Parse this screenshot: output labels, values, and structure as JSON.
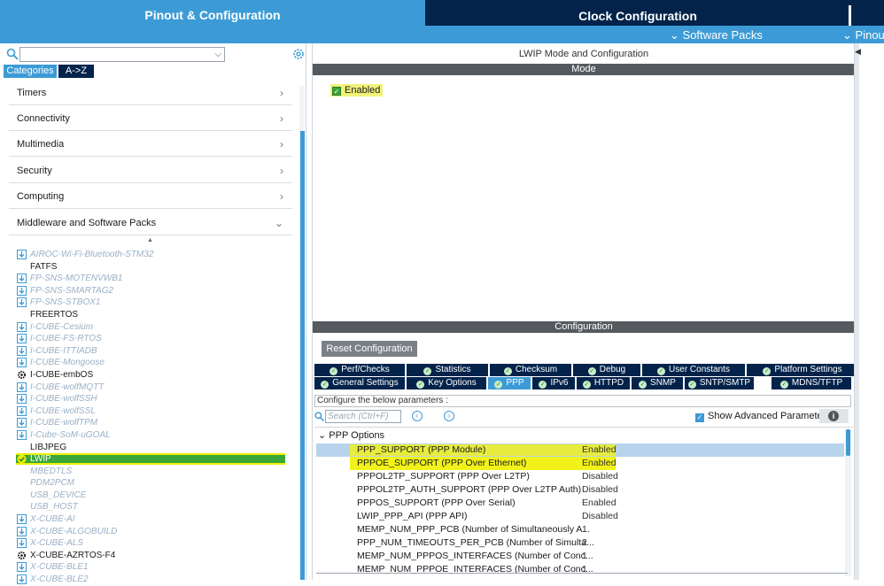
{
  "tabs": {
    "pinout": "Pinout & Configuration",
    "clock": "Clock Configuration"
  },
  "subbar": {
    "software_packs": "Software Packs",
    "pinout": "Pinout"
  },
  "left": {
    "search_value": "",
    "cat_tabs": [
      "Categories",
      "A->Z"
    ],
    "categories": [
      "Timers",
      "Connectivity",
      "Multimedia",
      "Security",
      "Computing",
      "Middleware and Software Packs"
    ],
    "packs": [
      {
        "label": "AIROC-Wi-Fi-Bluetooth-STM32",
        "style": "dim",
        "icon": "download"
      },
      {
        "label": "FATFS",
        "style": "norm",
        "icon": "none"
      },
      {
        "label": "FP-SNS-MOTENVWB1",
        "style": "dim",
        "icon": "download"
      },
      {
        "label": "FP-SNS-SMARTAG2",
        "style": "dim",
        "icon": "download"
      },
      {
        "label": "FP-SNS-STBOX1",
        "style": "dim",
        "icon": "download"
      },
      {
        "label": "FREERTOS",
        "style": "norm",
        "icon": "none"
      },
      {
        "label": "I-CUBE-Cesium",
        "style": "dim",
        "icon": "download"
      },
      {
        "label": "I-CUBE-FS-RTOS",
        "style": "dim",
        "icon": "download"
      },
      {
        "label": "I-CUBE-ITTIADB",
        "style": "dim",
        "icon": "download"
      },
      {
        "label": "I-CUBE-Mongoose",
        "style": "dim",
        "icon": "download"
      },
      {
        "label": "I-CUBE-embOS",
        "style": "norm",
        "icon": "gear"
      },
      {
        "label": "I-CUBE-wolfMQTT",
        "style": "dim",
        "icon": "download"
      },
      {
        "label": "I-CUBE-wolfSSH",
        "style": "dim",
        "icon": "download"
      },
      {
        "label": "I-CUBE-wolfSSL",
        "style": "dim",
        "icon": "download"
      },
      {
        "label": "I-CUBE-wolfTPM",
        "style": "dim",
        "icon": "download"
      },
      {
        "label": "I-Cube-SoM-uGOAL",
        "style": "dim",
        "icon": "download"
      },
      {
        "label": "LIBJPEG",
        "style": "norm",
        "icon": "none"
      },
      {
        "label": "LWIP",
        "style": "sel",
        "icon": "check"
      },
      {
        "label": "MBEDTLS",
        "style": "dim",
        "icon": "none"
      },
      {
        "label": "PDM2PCM",
        "style": "dim",
        "icon": "none"
      },
      {
        "label": "USB_DEVICE",
        "style": "dim",
        "icon": "none"
      },
      {
        "label": "USB_HOST",
        "style": "dim",
        "icon": "none"
      },
      {
        "label": "X-CUBE-AI",
        "style": "dim",
        "icon": "download"
      },
      {
        "label": "X-CUBE-ALGOBUILD",
        "style": "dim",
        "icon": "download"
      },
      {
        "label": "X-CUBE-ALS",
        "style": "dim",
        "icon": "download"
      },
      {
        "label": "X-CUBE-AZRTOS-F4",
        "style": "norm",
        "icon": "gear"
      },
      {
        "label": "X-CUBE-BLE1",
        "style": "dim",
        "icon": "download"
      },
      {
        "label": "X-CUBE-BLE2",
        "style": "dim",
        "icon": "download"
      }
    ]
  },
  "right": {
    "title": "LWIP Mode and Configuration",
    "mode_header": "Mode",
    "enabled_label": "Enabled",
    "config_header": "Configuration",
    "reset_label": "Reset Configuration",
    "tab_row1": [
      "Perf/Checks",
      "Statistics",
      "Checksum",
      "Debug",
      "User Constants",
      "Platform Settings"
    ],
    "tab_row2": [
      "General Settings",
      "Key Options",
      "PPP",
      "IPv6",
      "HTTPD",
      "SNMP",
      "SNTP/SMTP",
      "MDNS/TFTP"
    ],
    "configure_label": "Configure the below parameters :",
    "search_placeholder": "Search (Ctrl+F)",
    "show_advanced": "Show Advanced Parameters",
    "group_label": "PPP Options",
    "params": [
      {
        "name": "PPP_SUPPORT (PPP Module)",
        "value": "Enabled"
      },
      {
        "name": "PPPOE_SUPPORT (PPP Over Ethernet)",
        "value": "Enabled"
      },
      {
        "name": "PPPOL2TP_SUPPORT (PPP Over L2TP)",
        "value": "Disabled"
      },
      {
        "name": "PPPOL2TP_AUTH_SUPPORT (PPP Over L2TP Auth)",
        "value": "Disabled"
      },
      {
        "name": "PPPOS_SUPPORT (PPP Over Serial)",
        "value": "Enabled"
      },
      {
        "name": "LWIP_PPP_API (PPP API)",
        "value": "Disabled"
      },
      {
        "name": "MEMP_NUM_PPP_PCB (Number of Simultaneously A...",
        "value": "1"
      },
      {
        "name": "PPP_NUM_TIMEOUTS_PER_PCB (Number of Simulta...",
        "value": "2"
      },
      {
        "name": "MEMP_NUM_PPPOS_INTERFACES (Number of Conc...",
        "value": "1"
      },
      {
        "name": "MEMP_NUM_PPPOE_INTERFACES (Number of Conc...",
        "value": "1"
      }
    ]
  },
  "colors": {
    "navy": "#03234b",
    "blue": "#3c9bd6",
    "highlight": "#f2f21a",
    "selected_green": "#3aa63a"
  }
}
